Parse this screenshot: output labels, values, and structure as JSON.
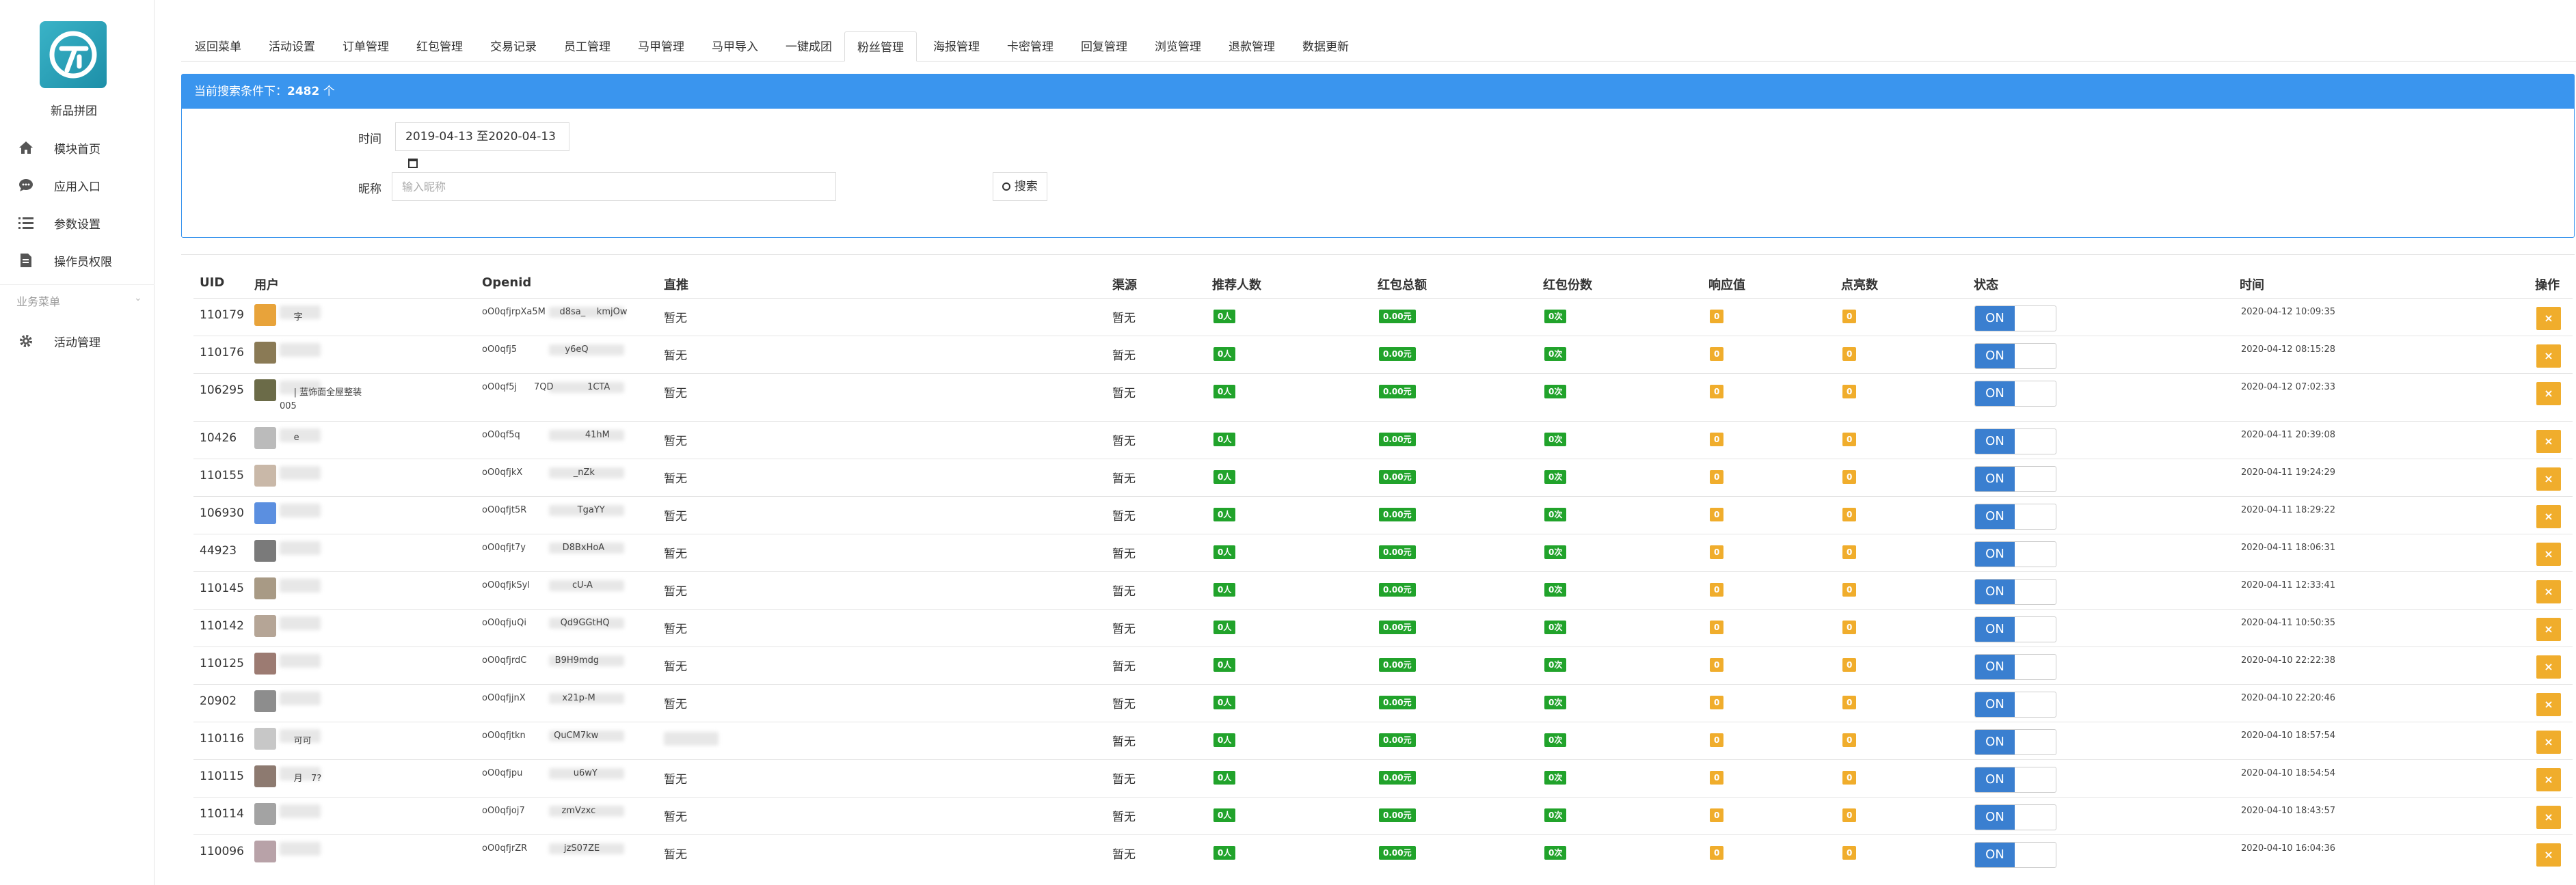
{
  "sidebar": {
    "brand": "新品拼团",
    "items": [
      {
        "label": "模块首页",
        "icon": "home-icon"
      },
      {
        "label": "应用入口",
        "icon": "chat-icon"
      },
      {
        "label": "参数设置",
        "icon": "list-icon"
      },
      {
        "label": "操作员权限",
        "icon": "document-icon"
      }
    ],
    "group_label": "业务菜单",
    "group_items": [
      {
        "label": "活动管理",
        "icon": "gear-icon"
      }
    ]
  },
  "tabs": [
    "返回菜单",
    "活动设置",
    "订单管理",
    "红包管理",
    "交易记录",
    "员工管理",
    "马甲管理",
    "马甲导入",
    "一键成团",
    "粉丝管理",
    "海报管理",
    "卡密管理",
    "回复管理",
    "浏览管理",
    "退款管理",
    "数据更新"
  ],
  "active_tab": "粉丝管理",
  "search": {
    "header_prefix": "当前搜索条件下：",
    "count": "2482",
    "count_suffix": " 个",
    "time_label": "时间",
    "date_range": "2019-04-13 至2020-04-13",
    "name_label": "昵称",
    "name_placeholder": "输入昵称",
    "search_button": "搜索"
  },
  "table": {
    "headers": [
      "UID",
      "用户",
      "Openid",
      "直推",
      "渠源",
      "推荐人数",
      "红包总额",
      "红包份数",
      "响应值",
      "点亮数",
      "状态",
      "时间",
      "操作"
    ],
    "rows": [
      {
        "uid": "110179",
        "user": "     字",
        "openid": "oO0qfjrpXa5M     d8sa_    kmjOw",
        "direct": "暂无",
        "source": "暂无",
        "refs": "0人",
        "amount": "0.00元",
        "shares": "0次",
        "resp": "0",
        "light": "0",
        "status": "ON",
        "time": "2020-04-12 10:09:35",
        "avatar_color": "#e8a33a"
      },
      {
        "uid": "110176",
        "user": "",
        "openid": "oO0qfj5                 y6eQ",
        "direct": "暂无",
        "source": "暂无",
        "refs": "0人",
        "amount": "0.00元",
        "shares": "0次",
        "resp": "0",
        "light": "0",
        "status": "ON",
        "time": "2020-04-12 08:15:28",
        "avatar_color": "#8a7a55"
      },
      {
        "uid": "106295",
        "user": "     | 蓝饰面全屋整装",
        "user2": "005",
        "openid": "oO0qf5j      7QD            1CTA",
        "direct": "暂无",
        "source": "暂无",
        "refs": "0人",
        "amount": "0.00元",
        "shares": "0次",
        "resp": "0",
        "light": "0",
        "status": "ON",
        "time": "2020-04-12 07:02:33",
        "avatar_color": "#6b6b48"
      },
      {
        "uid": "10426",
        "user": "     e",
        "openid": "oO0qf5q                       41hM",
        "direct": "暂无",
        "source": "暂无",
        "refs": "0人",
        "amount": "0.00元",
        "shares": "0次",
        "resp": "0",
        "light": "0",
        "status": "ON",
        "time": "2020-04-11 20:39:08",
        "avatar_color": "#bbbbbb"
      },
      {
        "uid": "110155",
        "user": "",
        "openid": "oO0qfjkX                  _nZk",
        "direct": "暂无",
        "source": "暂无",
        "refs": "0人",
        "amount": "0.00元",
        "shares": "0次",
        "resp": "0",
        "light": "0",
        "status": "ON",
        "time": "2020-04-11 19:24:29",
        "avatar_color": "#c9b8a8"
      },
      {
        "uid": "106930",
        "user": "",
        "openid": "oO0qfjt5R                  TgaYY",
        "direct": "暂无",
        "source": "暂无",
        "refs": "0人",
        "amount": "0.00元",
        "shares": "0次",
        "resp": "0",
        "light": "0",
        "status": "ON",
        "time": "2020-04-11 18:29:22",
        "avatar_color": "#5b8fe0"
      },
      {
        "uid": "44923",
        "user": "",
        "openid": "oO0qfjt7y             D8BxHoA",
        "direct": "暂无",
        "source": "暂无",
        "refs": "0人",
        "amount": "0.00元",
        "shares": "0次",
        "resp": "0",
        "light": "0",
        "status": "ON",
        "time": "2020-04-11 18:06:31",
        "avatar_color": "#7a7a7a"
      },
      {
        "uid": "110145",
        "user": "",
        "openid": "oO0qfjkSyl               cU-A",
        "direct": "暂无",
        "source": "暂无",
        "refs": "0人",
        "amount": "0.00元",
        "shares": "0次",
        "resp": "0",
        "light": "0",
        "status": "ON",
        "time": "2020-04-11 12:33:41",
        "avatar_color": "#a89a85"
      },
      {
        "uid": "110142",
        "user": "",
        "openid": "oO0qfjuQi            Qd9GGtHQ",
        "direct": "暂无",
        "source": "暂无",
        "refs": "0人",
        "amount": "0.00元",
        "shares": "0次",
        "resp": "0",
        "light": "0",
        "status": "ON",
        "time": "2020-04-11 10:50:35",
        "avatar_color": "#b5a596"
      },
      {
        "uid": "110125",
        "user": "",
        "openid": "oO0qfjrdC          B9H9mdg",
        "direct": "暂无",
        "source": "暂无",
        "refs": "0人",
        "amount": "0.00元",
        "shares": "0次",
        "resp": "0",
        "light": "0",
        "status": "ON",
        "time": "2020-04-10 22:22:38",
        "avatar_color": "#9c7b72"
      },
      {
        "uid": "20902",
        "user": "",
        "openid": "oO0qfjjnX             x21p-M",
        "direct": "暂无",
        "source": "暂无",
        "refs": "0人",
        "amount": "0.00元",
        "shares": "0次",
        "resp": "0",
        "light": "0",
        "status": "ON",
        "time": "2020-04-10 22:20:46",
        "avatar_color": "#8d8d8d"
      },
      {
        "uid": "110116",
        "user": "     可可",
        "openid": "oO0qfjtkn          QuCM7kw",
        "direct": "",
        "source": "暂无",
        "refs": "0人",
        "amount": "0.00元",
        "shares": "0次",
        "resp": "0",
        "light": "0",
        "status": "ON",
        "time": "2020-04-10 18:57:54",
        "avatar_color": "#c7c7c7"
      },
      {
        "uid": "110115",
        "user": "     月   7?",
        "openid": "oO0qfjpu                  u6wY",
        "direct": "暂无",
        "source": "暂无",
        "refs": "0人",
        "amount": "0.00元",
        "shares": "0次",
        "resp": "0",
        "light": "0",
        "status": "ON",
        "time": "2020-04-10 18:54:54",
        "avatar_color": "#8d7a70"
      },
      {
        "uid": "110114",
        "user": "",
        "openid": "oO0qfjoj7             zmVzxc",
        "direct": "暂无",
        "source": "暂无",
        "refs": "0人",
        "amount": "0.00元",
        "shares": "0次",
        "resp": "0",
        "light": "0",
        "status": "ON",
        "time": "2020-04-10 18:43:57",
        "avatar_color": "#a3a3a3"
      },
      {
        "uid": "110096",
        "user": "",
        "openid": "oO0qfjrZR             jzS07ZE",
        "direct": "暂无",
        "source": "暂无",
        "refs": "0人",
        "amount": "0.00元",
        "shares": "0次",
        "resp": "0",
        "light": "0",
        "status": "ON",
        "time": "2020-04-10 16:04:36",
        "avatar_color": "#b8a2a8"
      }
    ]
  },
  "colors": {
    "accent": "#3a95ee",
    "badge_green": "#21a32b",
    "badge_orange": "#f0ad2c",
    "toggle_on": "#3a7fd0"
  }
}
